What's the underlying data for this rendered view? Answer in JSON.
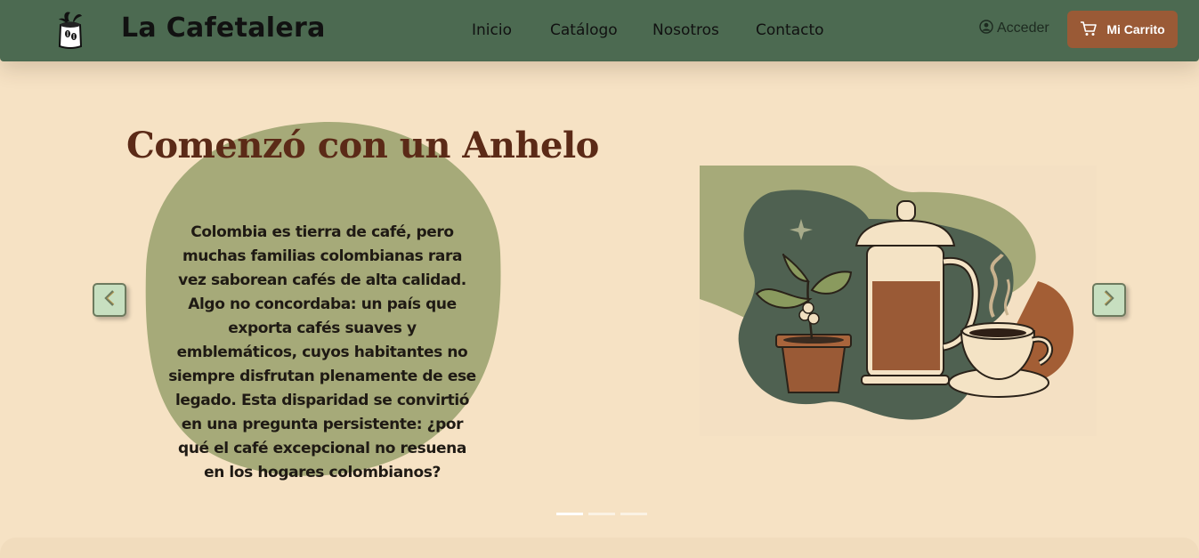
{
  "brand": {
    "name": "La Cafetalera"
  },
  "nav": {
    "items": [
      {
        "label": "Inicio"
      },
      {
        "label": "Catálogo"
      },
      {
        "label": "Nosotros"
      },
      {
        "label": "Contacto"
      }
    ],
    "login_label": "Acceder",
    "cart_label": "Mi Carrito"
  },
  "hero": {
    "title": "Comenzó con un Anhelo",
    "body": "Colombia es tierra de café, pero muchas familias colombianas rara vez saborean cafés de alta calidad. Algo no concordaba: un país que exporta cafés suaves y emblemáticos, cuyos habitantes no siempre disfrutan plenamente de ese legado. Esta disparidad se convirtió en una pregunta persistente: ¿por qué el café excepcional no resuena en los hogares colombianos?",
    "illustration_icon": "coffee-press-plant-cup-illustration"
  },
  "carousel": {
    "slide_count": 3,
    "active_index": 0
  },
  "colors": {
    "navbar": "#4c6a51",
    "page_background": "#f6e2c4",
    "accent_brown": "#9a5a36",
    "title_brown": "#5b2a17",
    "blob_green": "#a6aa79",
    "arrow_bg": "#c7dfc0"
  },
  "icons": [
    "coffee-sack-logo-icon",
    "user-circle-icon",
    "cart-icon",
    "chevron-left-icon",
    "chevron-right-icon"
  ]
}
